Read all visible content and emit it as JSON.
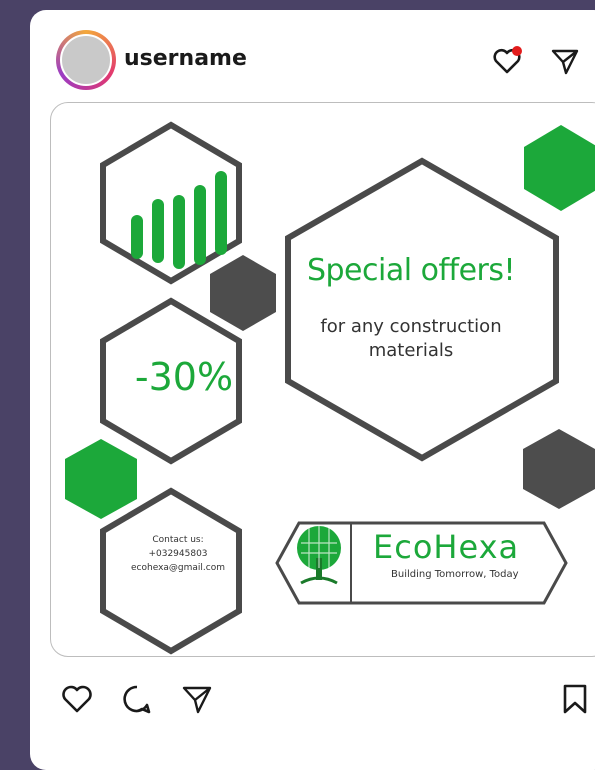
{
  "header": {
    "username": "username",
    "icons": {
      "heart": "heart-icon",
      "notification_dot_color": "#e21c1c",
      "send": "send-icon"
    }
  },
  "post": {
    "headline": "Special offers!",
    "subline_1": "for any construction",
    "subline_2": "materials",
    "discount": "-30%",
    "contact": {
      "label": "Contact us:",
      "phone": "+032945803",
      "email": "ecohexa@gmail.com"
    },
    "brand": {
      "name": "EcoHexa",
      "tagline": "Building Tomorrow, Today"
    },
    "colors": {
      "accent_green": "#1ca83a",
      "hex_dark": "#4d4d4d",
      "outline": "#4a4a4a"
    }
  },
  "actions": {
    "like": "heart-icon",
    "comment": "comment-icon",
    "share": "send-icon",
    "save": "bookmark-icon"
  }
}
